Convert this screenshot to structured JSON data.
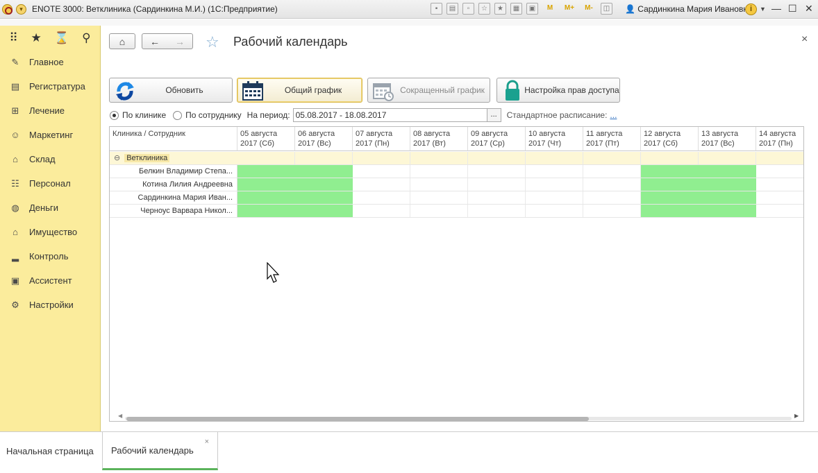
{
  "window": {
    "title": "ENOTE 3000: Ветклиника (Сардинкина М.И.) (1С:Предприятие)",
    "user": "Сардинкина Мария Ивановна",
    "user_icon": "user-icon"
  },
  "sidebar": {
    "items": [
      {
        "label": "Главное",
        "icon": "paperclip-icon",
        "glyph": "✎"
      },
      {
        "label": "Регистратура",
        "icon": "registry-icon",
        "glyph": "▤"
      },
      {
        "label": "Лечение",
        "icon": "medical-kit-icon",
        "glyph": "⊞"
      },
      {
        "label": "Маркетинг",
        "icon": "marketing-icon",
        "glyph": "☺"
      },
      {
        "label": "Склад",
        "icon": "warehouse-icon",
        "glyph": "⌂"
      },
      {
        "label": "Персонал",
        "icon": "staff-icon",
        "glyph": "☷"
      },
      {
        "label": "Деньги",
        "icon": "money-icon",
        "glyph": "◍"
      },
      {
        "label": "Имущество",
        "icon": "property-icon",
        "glyph": "⌂"
      },
      {
        "label": "Контроль",
        "icon": "chart-icon",
        "glyph": "▂"
      },
      {
        "label": "Ассистент",
        "icon": "assistant-icon",
        "glyph": "▣"
      },
      {
        "label": "Настройки",
        "icon": "wrench-icon",
        "glyph": "⚙"
      }
    ]
  },
  "header": {
    "title": "Рабочий календарь"
  },
  "toolbar": {
    "refresh": "Обновить",
    "general_schedule": "Общий график",
    "short_schedule": "Сокращенный график",
    "access_settings": "Настройка прав доступа"
  },
  "filters": {
    "by_clinic": "По клинике",
    "by_employee": "По сотруднику",
    "period_label": "На период:",
    "period_value": "05.08.2017 - 18.08.2017",
    "dots": "...",
    "standard_schedule_label": "Стандартное расписание:",
    "standard_schedule_link": "..."
  },
  "grid": {
    "first_column_header": "Клиника / Сотрудник",
    "days": [
      {
        "line1": "05 августа",
        "line2": "2017 (Сб)"
      },
      {
        "line1": "06 августа",
        "line2": "2017 (Вс)"
      },
      {
        "line1": "07 августа",
        "line2": "2017 (Пн)"
      },
      {
        "line1": "08 августа",
        "line2": "2017 (Вт)"
      },
      {
        "line1": "09 августа",
        "line2": "2017 (Ср)"
      },
      {
        "line1": "10 августа",
        "line2": "2017 (Чт)"
      },
      {
        "line1": "11 августа",
        "line2": "2017 (Пт)"
      },
      {
        "line1": "12 августа",
        "line2": "2017 (Сб)"
      },
      {
        "line1": "13 августа",
        "line2": "2017 (Вс)"
      },
      {
        "line1": "14 августа",
        "line2": "2017 (Пн)"
      }
    ],
    "group": {
      "label": "Ветклиника",
      "expander": "⊖"
    },
    "employees": [
      {
        "name": "Белкин Владимир Степа...",
        "busy_days": [
          0,
          1,
          7,
          8
        ]
      },
      {
        "name": "Котина Лилия Андреевна",
        "busy_days": [
          0,
          1,
          7,
          8
        ]
      },
      {
        "name": "Сардинкина Мария Иван...",
        "busy_days": [
          0,
          1,
          7,
          8
        ]
      },
      {
        "name": "Черноус Варвара Никол...",
        "busy_days": [
          0,
          1,
          7,
          8
        ]
      }
    ],
    "busy_color": "#90ee90"
  },
  "tabs": [
    {
      "label": "Начальная страница"
    },
    {
      "label": "Рабочий календарь",
      "close": "×"
    }
  ]
}
